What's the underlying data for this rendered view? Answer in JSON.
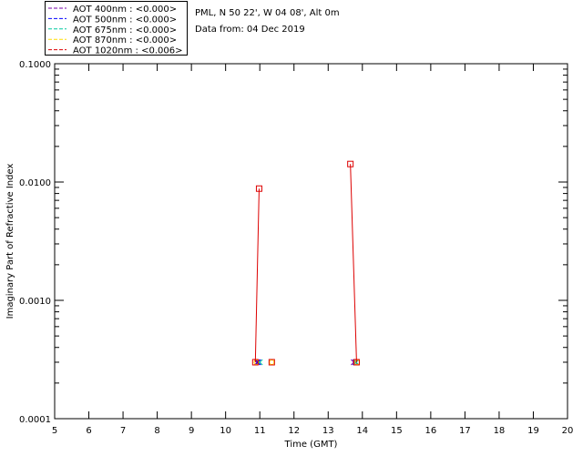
{
  "chart_data": {
    "type": "scatter",
    "header": {
      "station": "PML, N 50 22', W 04 08', Alt 0m",
      "date_line": "Data from: 04 Dec 2019"
    },
    "xlabel": "Time (GMT)",
    "ylabel": "Imaginary Part of Refractive Index",
    "xlim": [
      5,
      20
    ],
    "ylim": [
      0.0001,
      0.1
    ],
    "yscale": "log",
    "x_ticks": [
      5,
      6,
      7,
      8,
      9,
      10,
      11,
      12,
      13,
      14,
      15,
      16,
      17,
      18,
      19,
      20
    ],
    "y_ticks": [
      {
        "value": 0.0001,
        "label": "0.0001"
      },
      {
        "value": 0.001,
        "label": "0.0010"
      },
      {
        "value": 0.01,
        "label": "0.0100"
      },
      {
        "value": 0.1,
        "label": "0.1000"
      }
    ],
    "legend": [
      {
        "label": "AOT  400nm : <0.000>",
        "color": "#7700aa"
      },
      {
        "label": "AOT  500nm : <0.000>",
        "color": "#0000ff"
      },
      {
        "label": "AOT  675nm : <0.000>",
        "color": "#00c8a0"
      },
      {
        "label": "AOT  870nm : <0.000>",
        "color": "#ffdd00"
      },
      {
        "label": "AOT 1020nm : <0.006>",
        "color": "#dd0000"
      }
    ],
    "series": [
      {
        "name": "400nm",
        "color": "#7700aa",
        "marker": "x",
        "points": [
          [
            10.92,
            0.0003
          ],
          [
            13.75,
            0.0003
          ]
        ]
      },
      {
        "name": "500nm",
        "color": "#0000ff",
        "marker": "x",
        "points": [
          [
            10.95,
            0.0003
          ],
          [
            13.8,
            0.0003
          ]
        ]
      },
      {
        "name": "675nm",
        "color": "#00c8a0",
        "marker": "x",
        "points": [
          [
            11.0,
            0.0003
          ],
          [
            13.82,
            0.0003
          ]
        ]
      },
      {
        "name": "870nm",
        "color": "#ffdd00",
        "marker": "o",
        "points": [
          [
            10.9,
            0.0003
          ],
          [
            11.35,
            0.0003
          ],
          [
            13.85,
            0.0003
          ]
        ]
      },
      {
        "name": "1020nm",
        "color": "#dd0000",
        "marker": "square",
        "line": true,
        "segments": [
          [
            [
              10.87,
              0.0003
            ],
            [
              10.98,
              0.0088
            ]
          ],
          [
            [
              13.65,
              0.0142
            ],
            [
              13.83,
              0.0003
            ]
          ]
        ],
        "points": [
          [
            10.87,
            0.0003
          ],
          [
            10.98,
            0.0088
          ],
          [
            11.35,
            0.0003
          ],
          [
            13.65,
            0.0142
          ],
          [
            13.83,
            0.0003
          ]
        ]
      }
    ]
  }
}
